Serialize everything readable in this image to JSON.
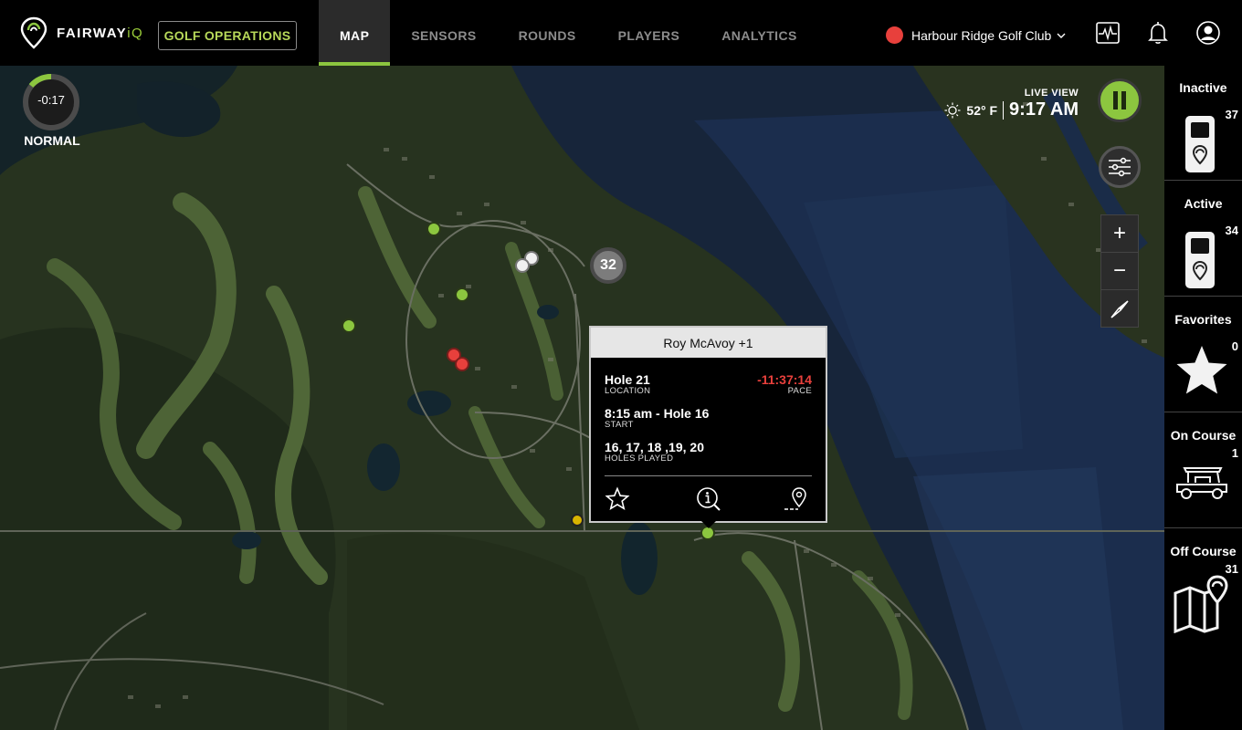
{
  "brand": {
    "logo_text_a": "FAIRWAY",
    "logo_text_b": "iQ",
    "accent": "#8cc63f",
    "alert": "#e8403c"
  },
  "header": {
    "ops_button": "GOLF OPERATIONS",
    "tabs": [
      {
        "label": "MAP",
        "active": true
      },
      {
        "label": "SENSORS",
        "active": false
      },
      {
        "label": "ROUNDS",
        "active": false
      },
      {
        "label": "PLAYERS",
        "active": false
      },
      {
        "label": "ANALYTICS",
        "active": false
      }
    ],
    "club_name": "Harbour Ridge Golf Club",
    "icons": [
      "pulse-icon",
      "bell-icon",
      "user-icon"
    ]
  },
  "map": {
    "timer_value": "-0:17",
    "status_label": "NORMAL",
    "live_title": "LIVE VIEW",
    "temperature": "52° F",
    "time": "9:17 AM",
    "cluster_count": "32",
    "zoom_in": "+",
    "zoom_out": "−"
  },
  "popup": {
    "title": "Roy McAvoy +1",
    "location_value": "Hole  21",
    "location_label": "LOCATION",
    "pace_value": "-11:37:14",
    "pace_label": "PACE",
    "start_value": "8:15 am - Hole 16",
    "start_label": "START",
    "holes_value": "16, 17, 18 ,19, 20",
    "holes_label": "HOLES PLAYED"
  },
  "sidebar": [
    {
      "label": "Inactive",
      "count": "37",
      "icon": "device-icon"
    },
    {
      "label": "Active",
      "count": "34",
      "icon": "device-icon"
    },
    {
      "label": "Favorites",
      "count": "0",
      "icon": "star-icon"
    },
    {
      "label": "On Course",
      "count": "1",
      "icon": "golf-cart-icon"
    },
    {
      "label": "Off Course",
      "count": "31",
      "icon": "map-pin-icon"
    }
  ]
}
